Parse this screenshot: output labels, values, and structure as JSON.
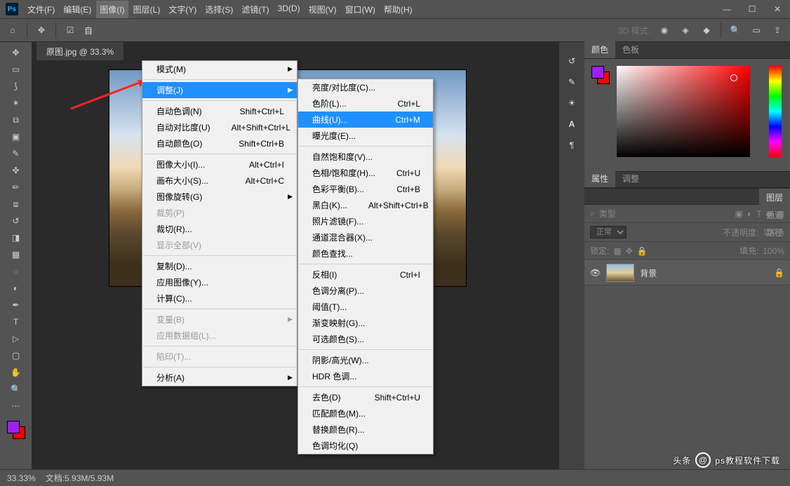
{
  "titlebar": {
    "logo": "Ps"
  },
  "menu_bar": {
    "file": "文件(F)",
    "edit": "编辑(E)",
    "image": "图像(I)",
    "layer": "图层(L)",
    "type": "文字(Y)",
    "select": "选择(S)",
    "filter": "滤镜(T)",
    "threeD": "3D(D)",
    "view": "视图(V)",
    "window": "窗口(W)",
    "help": "帮助(H)"
  },
  "options_bar": {
    "auto": "自",
    "threeD_mode": "3D 模式:"
  },
  "doc_tab": {
    "title": "原图.jpg @ 33.3%"
  },
  "menu1": {
    "mode": "模式(M)",
    "adjust": "调整(J)",
    "auto_tone": {
      "label": "自动色调(N)",
      "shortcut": "Shift+Ctrl+L"
    },
    "auto_contrast": {
      "label": "自动对比度(U)",
      "shortcut": "Alt+Shift+Ctrl+L"
    },
    "auto_color": {
      "label": "自动颜色(O)",
      "shortcut": "Shift+Ctrl+B"
    },
    "image_size": {
      "label": "图像大小(I)...",
      "shortcut": "Alt+Ctrl+I"
    },
    "canvas_size": {
      "label": "画布大小(S)...",
      "shortcut": "Alt+Ctrl+C"
    },
    "rotate": "图像旋转(G)",
    "crop": "裁剪(P)",
    "trim": "裁切(R)...",
    "reveal_all": "显示全部(V)",
    "duplicate": "复制(D)...",
    "apply_image": "应用图像(Y)...",
    "calculations": "计算(C)...",
    "variables": "变量(B)",
    "apply_dataset": "应用数据组(L)...",
    "trap": "陷印(T)...",
    "analysis": "分析(A)"
  },
  "menu2": {
    "brightness": "亮度/对比度(C)...",
    "levels": {
      "label": "色阶(L)...",
      "shortcut": "Ctrl+L"
    },
    "curves": {
      "label": "曲线(U)...",
      "shortcut": "Ctrl+M"
    },
    "exposure": "曝光度(E)...",
    "vibrance": "自然饱和度(V)...",
    "hue_sat": {
      "label": "色相/饱和度(H)...",
      "shortcut": "Ctrl+U"
    },
    "color_bal": {
      "label": "色彩平衡(B)...",
      "shortcut": "Ctrl+B"
    },
    "bw": {
      "label": "黑白(K)...",
      "shortcut": "Alt+Shift+Ctrl+B"
    },
    "photo_filter": "照片滤镜(F)...",
    "channel_mixer": "通道混合器(X)...",
    "color_lookup": "颜色查找...",
    "invert": {
      "label": "反相(I)",
      "shortcut": "Ctrl+I"
    },
    "posterize": "色调分离(P)...",
    "threshold": "阈值(T)...",
    "gradient_map": "渐变映射(G)...",
    "selective_color": "可选颜色(S)...",
    "shadows_highlights": "阴影/高光(W)...",
    "hdr_toning": "HDR 色调...",
    "desaturate": {
      "label": "去色(D)",
      "shortcut": "Shift+Ctrl+U"
    },
    "match_color": "匹配颜色(M)...",
    "replace_color": "替换颜色(R)...",
    "equalize": "色调均化(Q)"
  },
  "panels": {
    "color_tab": "颜色",
    "swatches_tab": "色板",
    "props_tab": "属性",
    "adjust_tab": "调整",
    "layers_tab": "图层",
    "channels_tab": "通道",
    "paths_tab": "路径",
    "kind_ph": "类型",
    "blend_normal": "正常",
    "opacity_label": "不透明度:",
    "opacity_val": "100%",
    "lock_label": "锁定:",
    "fill_label": "填充:",
    "fill_val": "100%",
    "layer_bg": "背景"
  },
  "status": {
    "zoom": "33.33%",
    "doc_info": "文档:5.93M/5.93M"
  },
  "watermark": {
    "brand": "头条",
    "at": "@",
    "text": "ps教程软件下载"
  }
}
